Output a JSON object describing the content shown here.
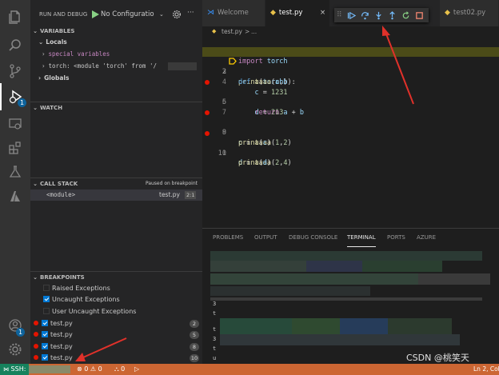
{
  "activity": {
    "icons": [
      "explorer-icon",
      "search-icon",
      "source-control-icon",
      "run-debug-icon",
      "remote-explorer-icon",
      "extensions-icon",
      "testing-icon",
      "azure-icon",
      "account-icon",
      "settings-gear-icon"
    ],
    "debug_badge": "1",
    "account_badge": "1"
  },
  "sidebar": {
    "header_title": "RUN AND DEBUG",
    "config_select": "No Configuratio",
    "variables": {
      "title": "VARIABLES",
      "locals_label": "Locals",
      "special_vars": "special variables",
      "torch_var": "torch: <module 'torch' from '/",
      "globals_label": "Globals"
    },
    "watch_title": "WATCH",
    "call_stack": {
      "title": "CALL STACK",
      "status": "Paused on breakpoint",
      "frame_name": "<module>",
      "frame_file": "test.py",
      "frame_pos": "2:1"
    },
    "breakpoints": {
      "title": "BREAKPOINTS",
      "items": [
        {
          "label": "Raised Exceptions",
          "checked": false
        },
        {
          "label": "Uncaught Exceptions",
          "checked": true
        },
        {
          "label": "User Uncaught Exceptions",
          "checked": false
        }
      ],
      "files": [
        {
          "label": "test.py",
          "count": "2"
        },
        {
          "label": "test.py",
          "count": "5"
        },
        {
          "label": "test.py",
          "count": "8"
        },
        {
          "label": "test.py",
          "count": "10"
        }
      ]
    }
  },
  "tabs": [
    {
      "label": "Welcome",
      "active": false
    },
    {
      "label": "test.py",
      "active": true,
      "close": "×"
    },
    {
      "label": "test02.py",
      "active": false
    }
  ],
  "breadcrumb": {
    "file": "test.py",
    "sep": ">",
    "rest": "..."
  },
  "code_lines": [
    {
      "n": "1",
      "text": "import torch"
    },
    {
      "n": "2",
      "text": "print(torch)"
    },
    {
      "n": "3",
      "text": "def aaaa(a,b):"
    },
    {
      "n": "4",
      "text": "    c = 1231"
    },
    {
      "n": "5",
      "text": "    d = 213"
    },
    {
      "n": "6",
      "text": "    return a + b"
    },
    {
      "n": "7",
      "text": ""
    },
    {
      "n": "8",
      "text": "c = aaaa(1,2)"
    },
    {
      "n": "9",
      "text": "print(c)"
    },
    {
      "n": "10",
      "text": "d = aaaa(2,4)"
    },
    {
      "n": "11",
      "text": "print(d)"
    }
  ],
  "panel": {
    "tabs": [
      "PROBLEMS",
      "OUTPUT",
      "DEBUG CONSOLE",
      "TERMINAL",
      "PORTS",
      "AZURE"
    ],
    "active_tab": "TERMINAL",
    "terminal_fragments": [
      "3",
      "t",
      "t",
      "3",
      "t",
      "u"
    ]
  },
  "status": {
    "remote": "SSH:",
    "errors": "0",
    "warnings": "0",
    "info": "0",
    "position": "Ln 2, Col",
    "watermark": "CSDN @桃笑天"
  },
  "colors": {
    "status_bg": "#cc6633",
    "annotation_arrow": "#e0312a",
    "breakpoint": "#e51400",
    "current_line": "#4b4b18"
  }
}
